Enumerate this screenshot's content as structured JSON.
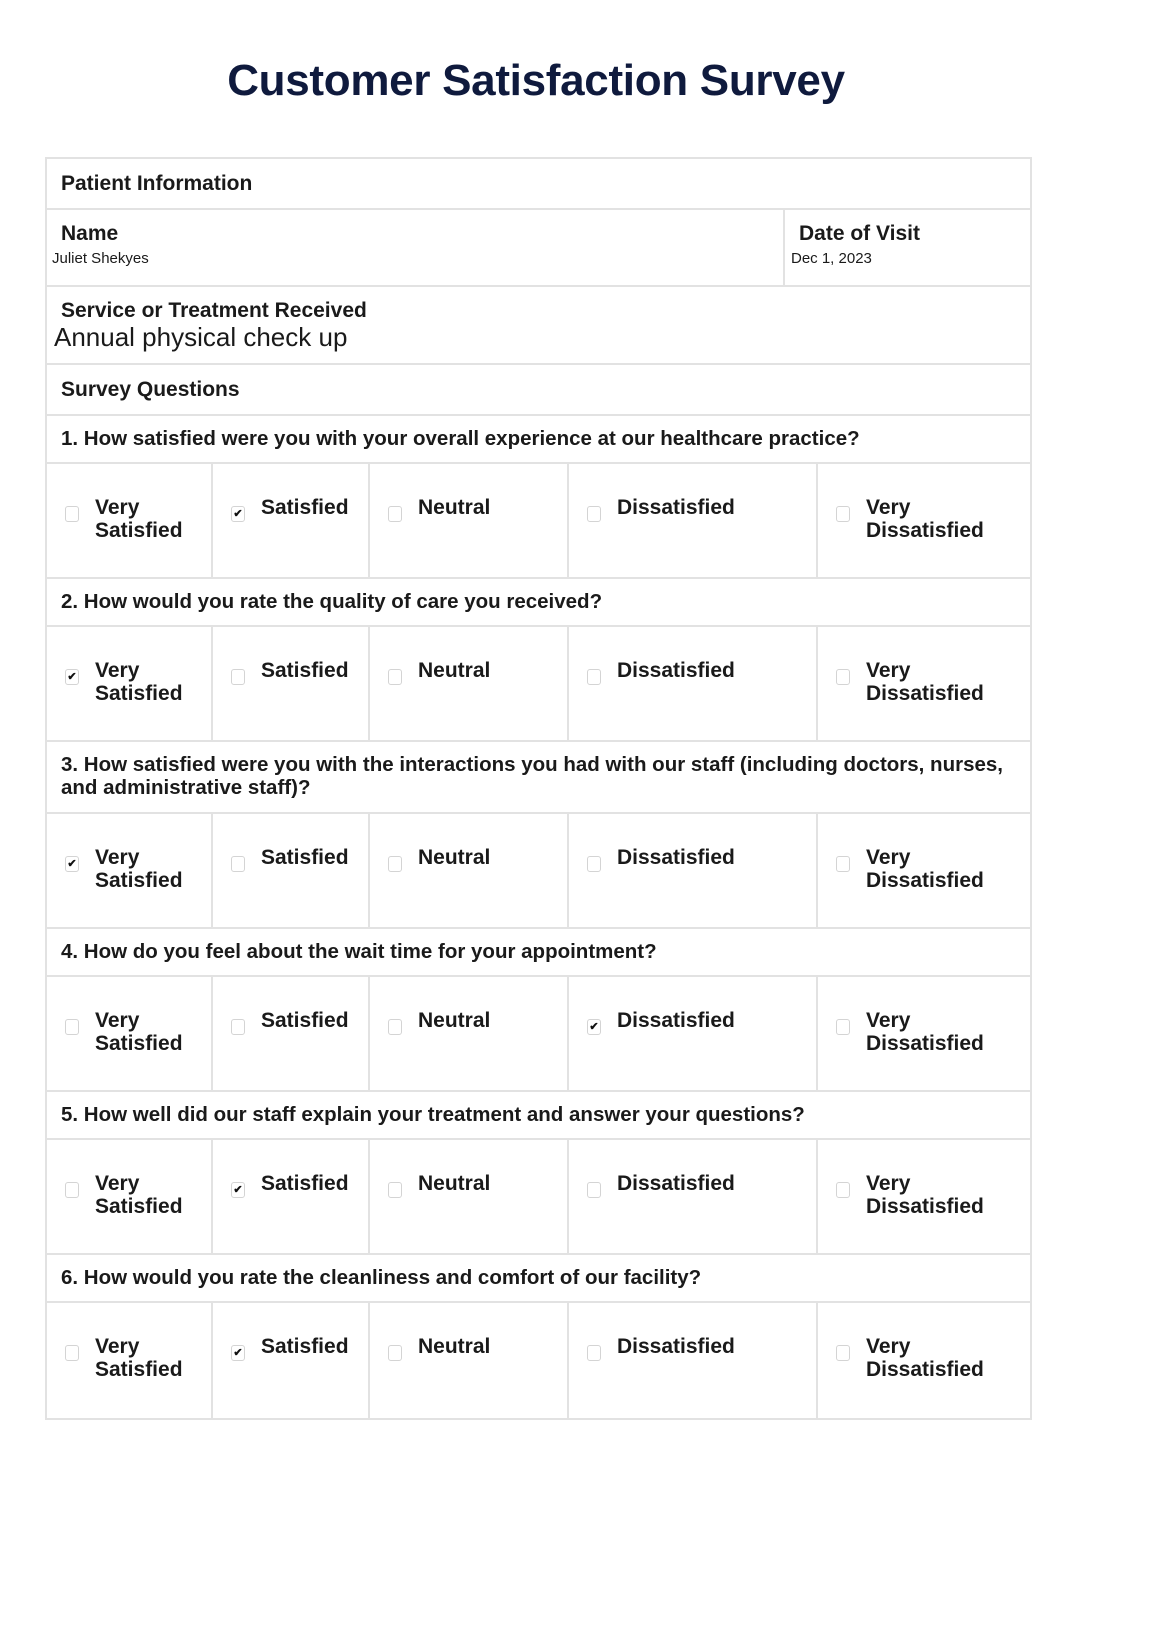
{
  "title": "Customer Satisfaction Survey",
  "patient_information": {
    "header": "Patient Information",
    "name_label": "Name",
    "name_value": "Juliet Shekyes",
    "date_label": "Date of Visit",
    "date_value": "Dec 1, 2023",
    "service_label": "Service or Treatment Received",
    "service_value": "Annual physical check up"
  },
  "survey": {
    "header": "Survey Questions",
    "options": [
      "Very Satisfied",
      "Satisfied",
      "Neutral",
      "Dissatisfied",
      "Very Dissatisfied"
    ],
    "options_display": [
      [
        "Very",
        "Satisfied"
      ],
      [
        "Satisfied"
      ],
      [
        "Neutral"
      ],
      [
        "Dissatisfied"
      ],
      [
        "Very",
        "Dissatisfied"
      ]
    ],
    "check_glyph": "✔",
    "questions": [
      {
        "text": "1. How satisfied were you with your overall experience at our healthcare practice?",
        "selected": "Satisfied"
      },
      {
        "text": "2. How would you rate the quality of care you received?",
        "selected": "Very Satisfied"
      },
      {
        "text": "3. How satisfied were you with the interactions you had with our staff (including doctors, nurses, and administrative staff)?",
        "selected": "Very Satisfied"
      },
      {
        "text": "4. How do you feel about the wait time for your appointment?",
        "selected": "Dissatisfied"
      },
      {
        "text": "5. How well did our staff explain your treatment and answer your questions?",
        "selected": "Satisfied"
      },
      {
        "text": "6. How would you rate the cleanliness and comfort of our facility?",
        "selected": "Satisfied"
      }
    ]
  }
}
